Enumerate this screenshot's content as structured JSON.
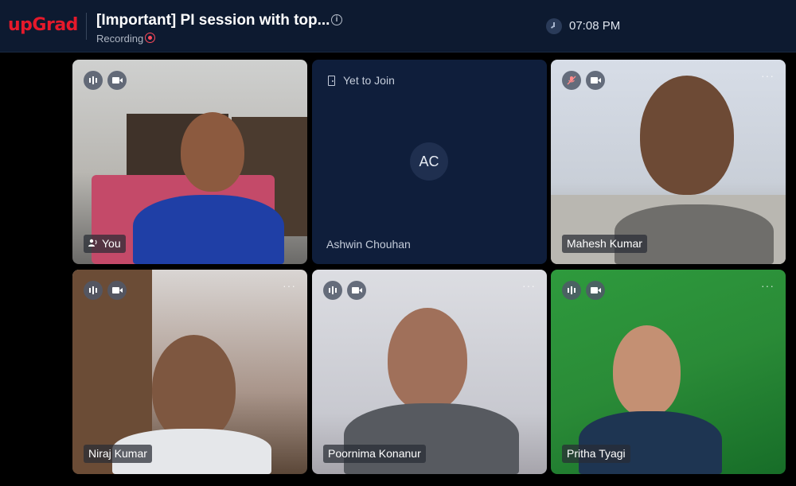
{
  "header": {
    "brand": "upGrad",
    "session_title": "[Important] PI session with top...",
    "recording_label": "Recording",
    "time": "07:08 PM"
  },
  "tiles": [
    {
      "name": "You",
      "status": "video",
      "mic": "on",
      "speaker_icon": true
    },
    {
      "name": "Ashwin Chouhan",
      "status": "Yet to Join",
      "initials": "AC"
    },
    {
      "name": "Mahesh Kumar",
      "status": "video",
      "mic": "muted"
    },
    {
      "name": "Niraj Kumar",
      "status": "video",
      "mic": "on"
    },
    {
      "name": "Poornima Konanur",
      "status": "video",
      "mic": "on"
    },
    {
      "name": "Pritha Tyagi",
      "status": "video",
      "mic": "on"
    }
  ],
  "colors": {
    "brand": "#e5192b",
    "header_bg": "#0d1a30",
    "tile_placeholder_bg": "#0f1e3b",
    "recording": "#ff4b5c"
  },
  "icons": [
    "info-icon",
    "record-icon",
    "clock-icon",
    "audio-level-icon",
    "camera-icon",
    "mic-muted-icon",
    "more-options-icon",
    "speaker-icon",
    "door-icon"
  ]
}
